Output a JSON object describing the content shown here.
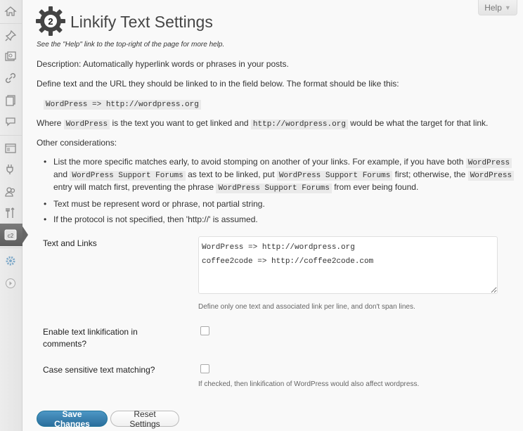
{
  "help_tab": {
    "label": "Help",
    "arrow": "▼"
  },
  "page": {
    "title": "Linkify Text Settings",
    "help_hint": "See the \"Help\" link to the top-right of the page for more help.",
    "description": "Description: Automatically hyperlink words or phrases in your posts.",
    "define": "Define text and the URL they should be linked to in the field below. The format should be like this:",
    "example": "WordPress => http://wordpress.org",
    "where": {
      "prefix": "Where ",
      "code1": "WordPress",
      "middle": " is the text you want to get linked and ",
      "code2": "http://wordpress.org",
      "suffix": " would be what the target for that link."
    },
    "other_heading": "Other considerations:",
    "considerations": [
      {
        "t1": "List the more specific matches early, to avoid stomping on another of your links. For example, if you have both ",
        "c1": "WordPress",
        "t2": " and ",
        "c2": "WordPress Support Forums",
        "t3": " as text to be linked, put ",
        "c3": "WordPress Support Forums",
        "t4": " first; otherwise, the ",
        "c4": "WordPress",
        "t5": " entry will match first, preventing the phrase ",
        "c5": "WordPress Support Forums",
        "t6": " from ever being found."
      },
      {
        "text": "Text must be represent word or phrase, not partial string."
      },
      {
        "text": "If the protocol is not specified, then 'http://' is assumed."
      }
    ]
  },
  "form": {
    "text_and_links_label": "Text and Links",
    "text_and_links_value": "WordPress => http://wordpress.org\ncoffee2code => http://coffee2code.com",
    "text_and_links_desc": "Define only one text and associated link per line, and don't span lines.",
    "linkify_comments_label": "Enable text linkification in comments?",
    "linkify_comments_checked": false,
    "case_sensitive_label": "Case sensitive text matching?",
    "case_sensitive_checked": false,
    "case_sensitive_desc": "If checked, then linkification of WordPress would also affect wordpress."
  },
  "buttons": {
    "save": "Save Changes",
    "reset": "Reset Settings"
  },
  "sidebar_icons": [
    "dashboard-icon",
    "posts-icon",
    "media-icon",
    "links-icon",
    "pages-icon",
    "comments-icon",
    "appearance-icon",
    "plugins-icon",
    "users-icon",
    "tools-icon",
    "settings-icon",
    "c2c-icon",
    "collapse-icon"
  ],
  "colors": {
    "primary_button": "#21759b",
    "sidebar_active": "#666666",
    "plugin_logo": "#444444"
  }
}
